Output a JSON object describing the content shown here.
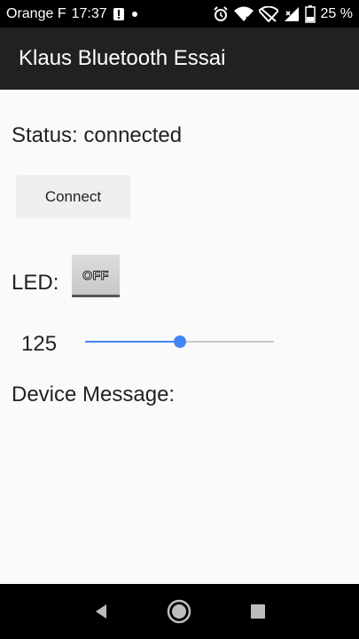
{
  "statusbar": {
    "carrier": "Orange F",
    "time": "17:37",
    "battery_percent": "25 %",
    "icons": [
      "alert-icon",
      "dot-icon",
      "alarm-icon",
      "wifi-icon",
      "no-sim-icon",
      "signal-icon",
      "battery-icon"
    ]
  },
  "appbar": {
    "title": "Klaus Bluetooth Essai"
  },
  "main": {
    "status_text": "Status: connected",
    "connect_label": "Connect",
    "led_label": "LED:",
    "led_toggle_label": "OFF",
    "slider_value_text": "125",
    "slider_fraction": 0.5,
    "device_message_label": "Device Message:"
  },
  "colors": {
    "accent": "#4285f4",
    "appbar_bg": "#212121",
    "statusbar_bg": "#000000",
    "content_bg": "#fafafa"
  },
  "navbar": {
    "icons": [
      "back-icon",
      "home-icon",
      "recents-icon"
    ]
  }
}
